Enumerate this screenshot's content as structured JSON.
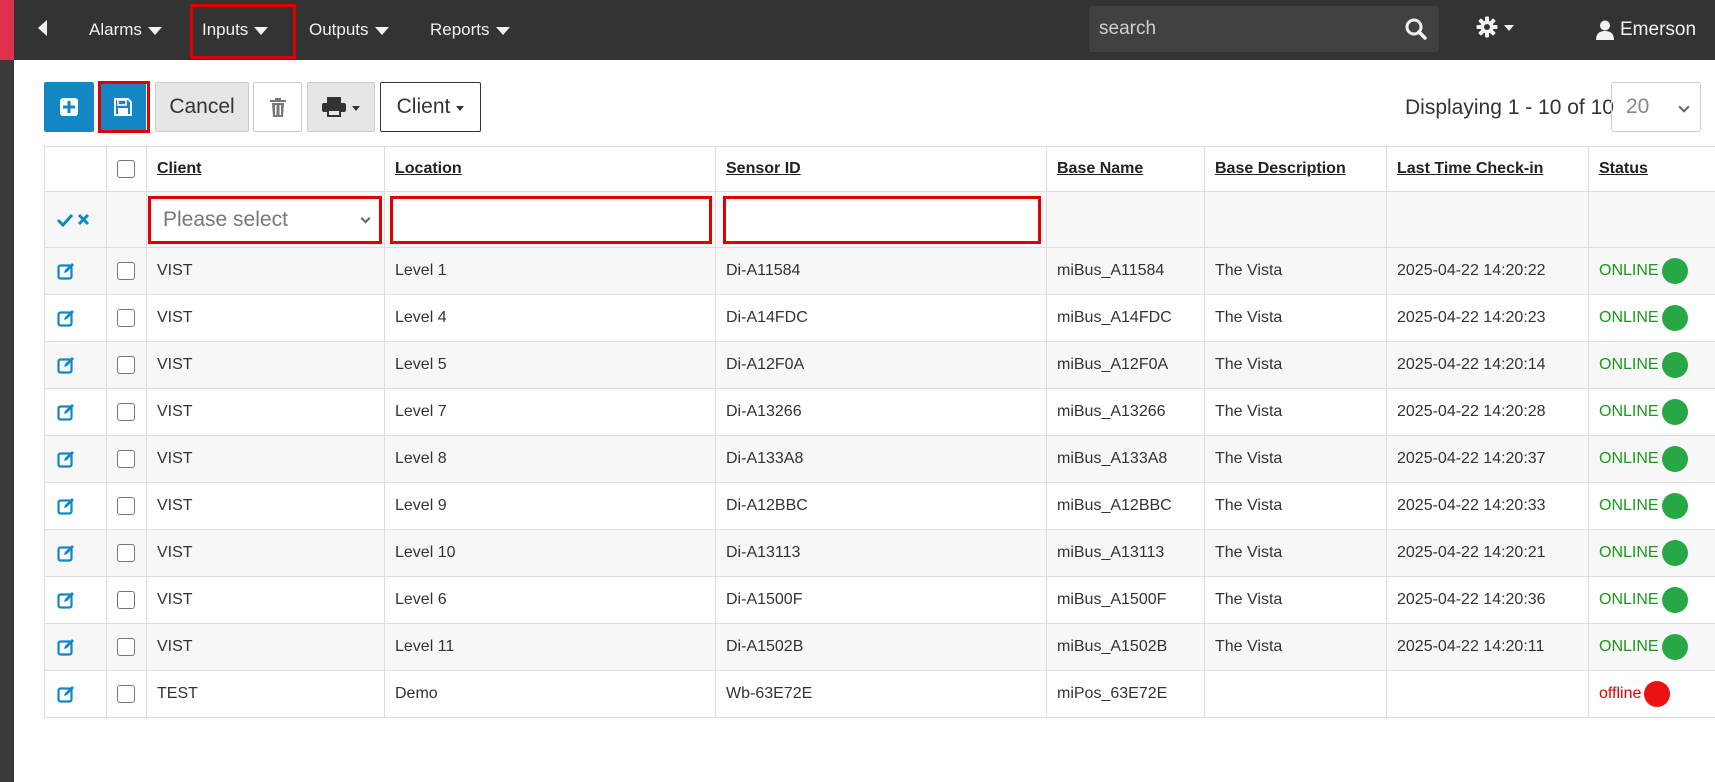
{
  "nav": {
    "items": [
      {
        "label": "Alarms"
      },
      {
        "label": "Inputs"
      },
      {
        "label": "Outputs"
      },
      {
        "label": "Reports"
      }
    ],
    "search_placeholder": "search",
    "user_name": "Emerson"
  },
  "toolbar": {
    "cancel_label": "Cancel",
    "client_label": "Client",
    "displaying": "Displaying 1 - 10 of 10",
    "page_size": "20"
  },
  "table": {
    "headers": [
      "Client",
      "Location",
      "Sensor ID",
      "Base Name",
      "Base Description",
      "Last Time Check-in",
      "Status"
    ],
    "filter": {
      "client_placeholder": "Please select"
    },
    "rows": [
      {
        "client": "VIST",
        "location": "Level 1",
        "sensor": "Di-A11584",
        "base_name": "miBus_A11584",
        "base_desc": "The Vista",
        "checkin": "2025-04-22 14:20:22",
        "status": "ONLINE"
      },
      {
        "client": "VIST",
        "location": "Level 4",
        "sensor": "Di-A14FDC",
        "base_name": "miBus_A14FDC",
        "base_desc": "The Vista",
        "checkin": "2025-04-22 14:20:23",
        "status": "ONLINE"
      },
      {
        "client": "VIST",
        "location": "Level 5",
        "sensor": "Di-A12F0A",
        "base_name": "miBus_A12F0A",
        "base_desc": "The Vista",
        "checkin": "2025-04-22 14:20:14",
        "status": "ONLINE"
      },
      {
        "client": "VIST",
        "location": "Level 7",
        "sensor": "Di-A13266",
        "base_name": "miBus_A13266",
        "base_desc": "The Vista",
        "checkin": "2025-04-22 14:20:28",
        "status": "ONLINE"
      },
      {
        "client": "VIST",
        "location": "Level 8",
        "sensor": "Di-A133A8",
        "base_name": "miBus_A133A8",
        "base_desc": "The Vista",
        "checkin": "2025-04-22 14:20:37",
        "status": "ONLINE"
      },
      {
        "client": "VIST",
        "location": "Level 9",
        "sensor": "Di-A12BBC",
        "base_name": "miBus_A12BBC",
        "base_desc": "The Vista",
        "checkin": "2025-04-22 14:20:33",
        "status": "ONLINE"
      },
      {
        "client": "VIST",
        "location": "Level 10",
        "sensor": "Di-A13113",
        "base_name": "miBus_A13113",
        "base_desc": "The Vista",
        "checkin": "2025-04-22 14:20:21",
        "status": "ONLINE"
      },
      {
        "client": "VIST",
        "location": "Level 6",
        "sensor": "Di-A1500F",
        "base_name": "miBus_A1500F",
        "base_desc": "The Vista",
        "checkin": "2025-04-22 14:20:36",
        "status": "ONLINE"
      },
      {
        "client": "VIST",
        "location": "Level 11",
        "sensor": "Di-A1502B",
        "base_name": "miBus_A1502B",
        "base_desc": "The Vista",
        "checkin": "2025-04-22 14:20:11",
        "status": "ONLINE"
      },
      {
        "client": "TEST",
        "location": "Demo",
        "sensor": "Wb-63E72E",
        "base_name": "miPos_63E72E",
        "base_desc": "",
        "checkin": "",
        "status": "offline"
      }
    ]
  },
  "colors": {
    "navbar": "#333333",
    "primary_button": "#1387c4",
    "online": "#28a745",
    "offline": "#ee1111",
    "highlight": "#e00000"
  }
}
